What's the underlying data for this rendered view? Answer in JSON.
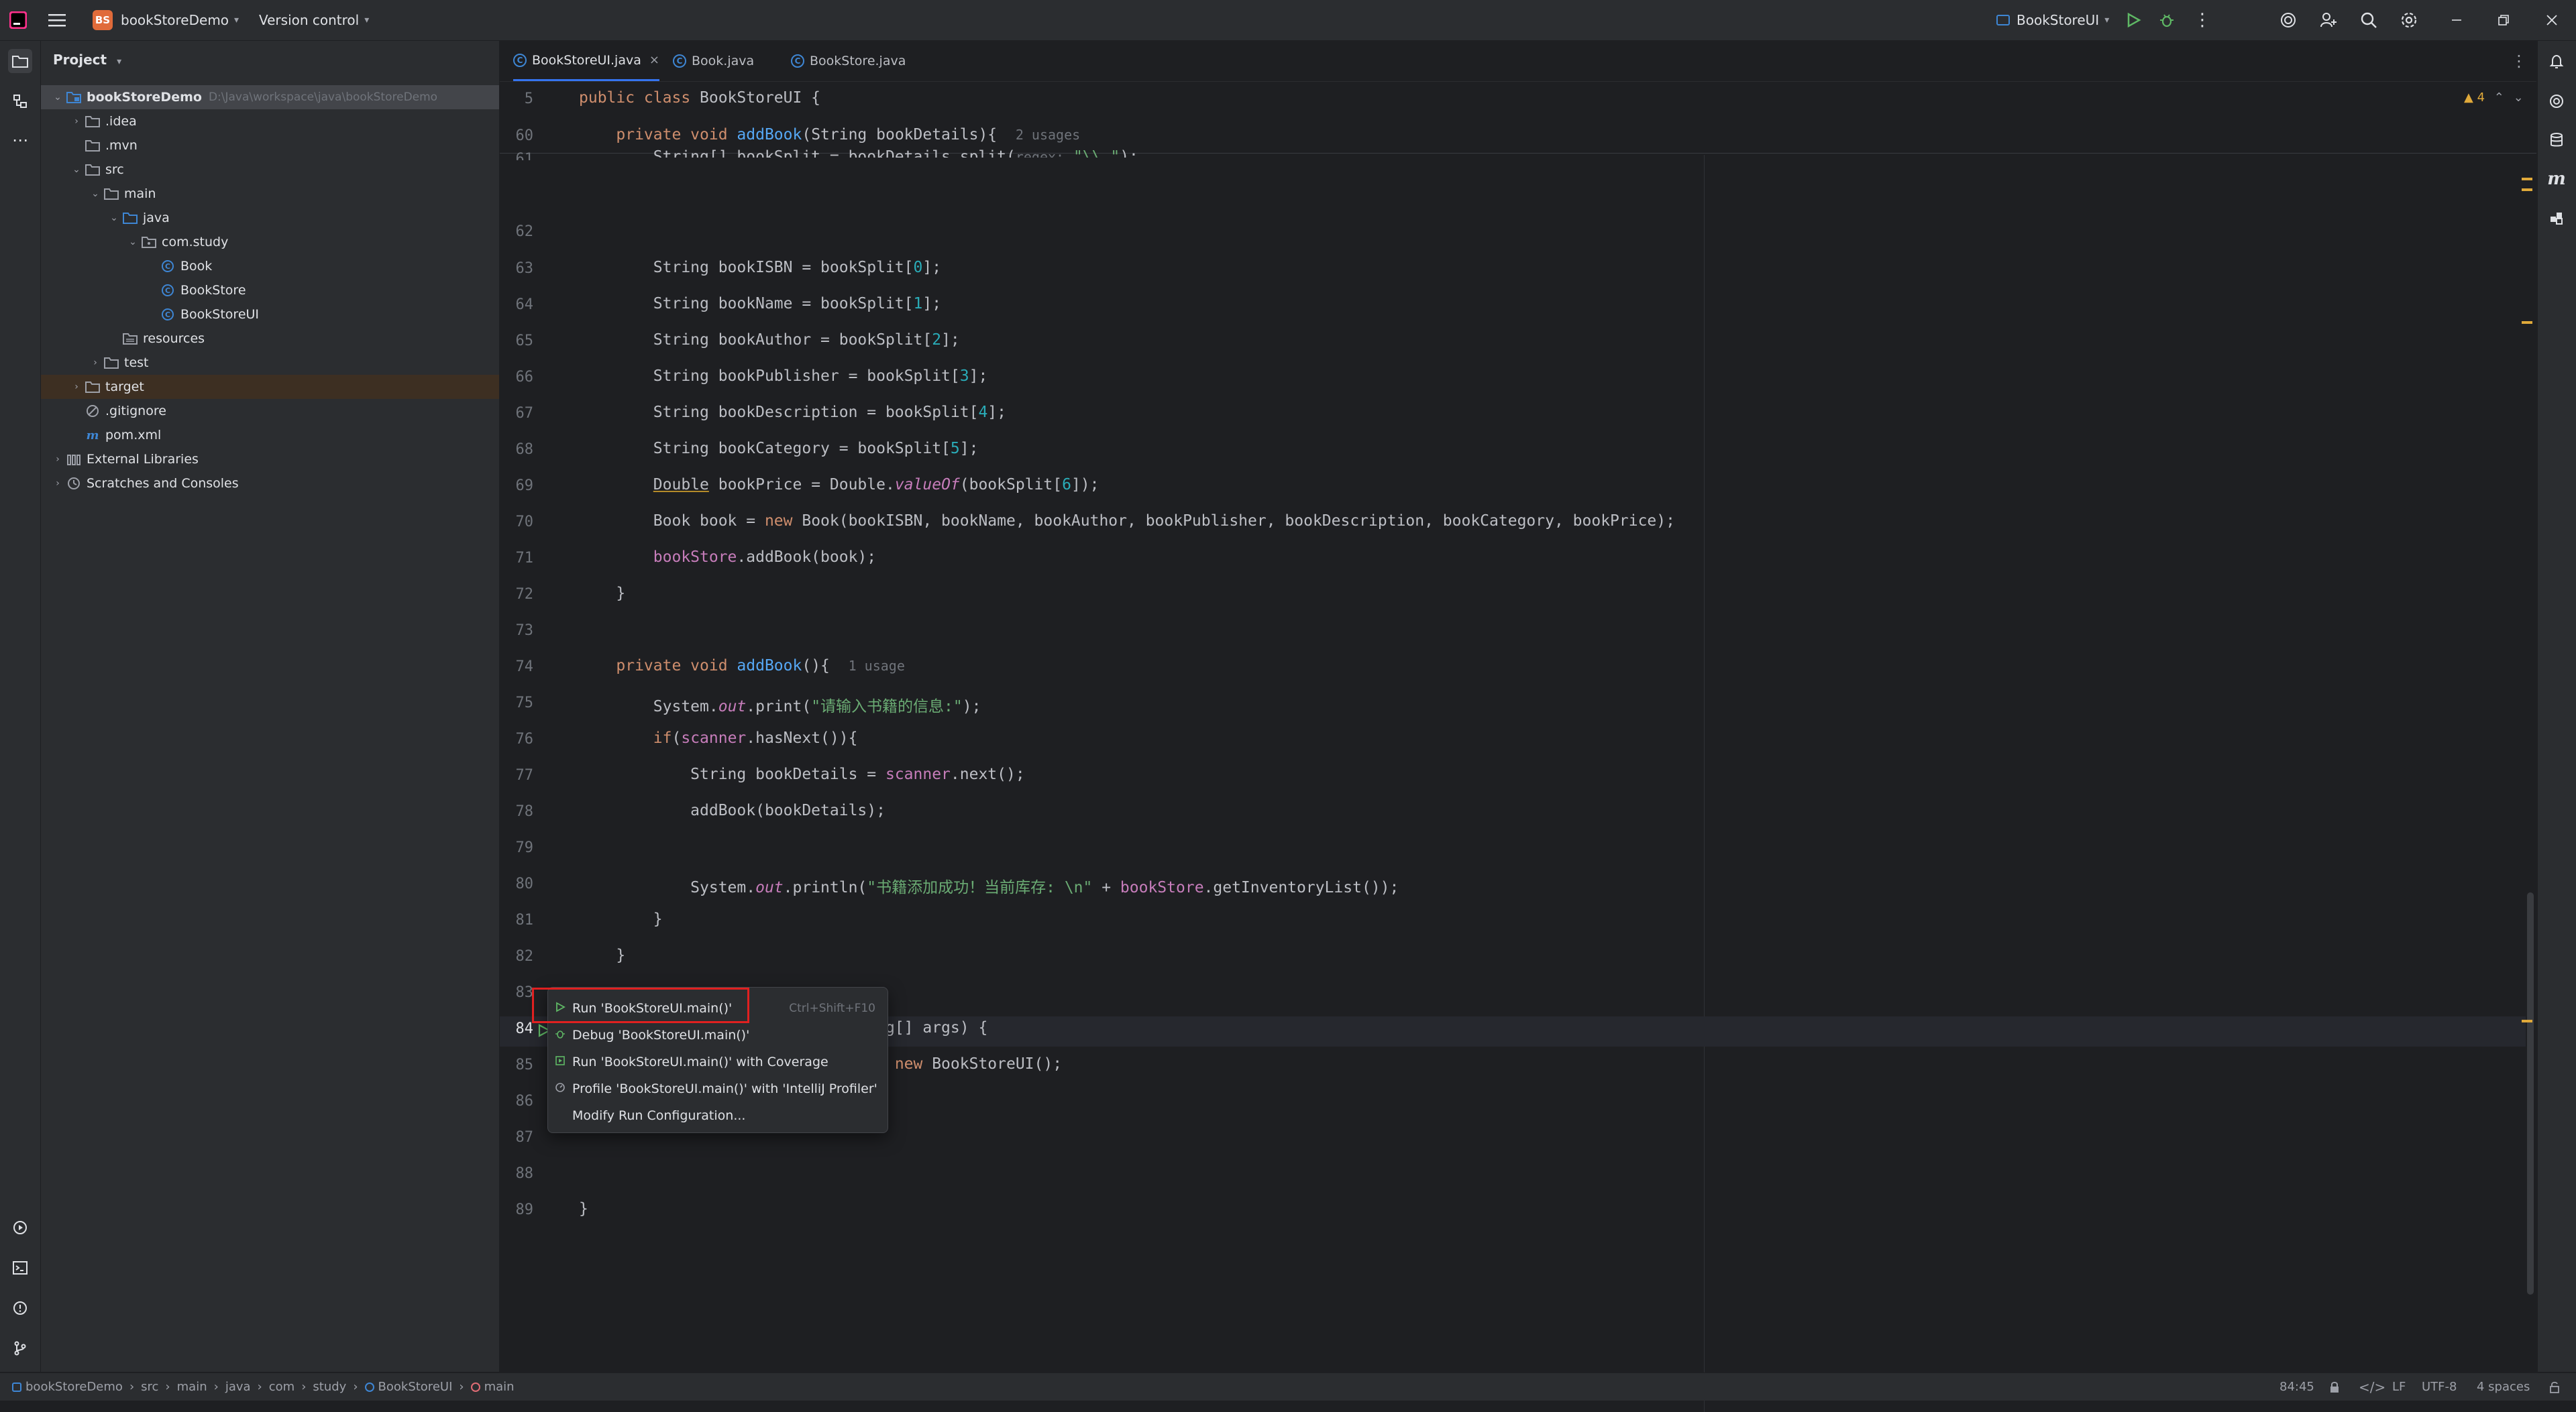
{
  "titlebar": {
    "project_initials": "BS",
    "project_name": "bookStoreDemo",
    "version_control": "Version control",
    "run_config": "BookStoreUI"
  },
  "project_panel": {
    "title": "Project",
    "tree": [
      {
        "label": "bookStoreDemo",
        "hint": "D:\\Java\\workspace\\java\\bookStoreDemo",
        "icon": "module-folder-icon",
        "arrow": "down",
        "depth": 0
      },
      {
        "label": ".idea",
        "icon": "folder-icon",
        "arrow": "right",
        "depth": 1
      },
      {
        "label": ".mvn",
        "icon": "folder-icon",
        "arrow": "",
        "depth": 1
      },
      {
        "label": "src",
        "icon": "folder-icon",
        "arrow": "down",
        "depth": 1
      },
      {
        "label": "main",
        "icon": "folder-icon",
        "arrow": "down",
        "depth": 2
      },
      {
        "label": "java",
        "icon": "source-folder-icon",
        "arrow": "down",
        "depth": 3
      },
      {
        "label": "com.study",
        "icon": "package-icon",
        "arrow": "down",
        "depth": 4
      },
      {
        "label": "Book",
        "icon": "class-icon",
        "arrow": "",
        "depth": 5
      },
      {
        "label": "BookStore",
        "icon": "class-icon",
        "arrow": "",
        "depth": 5
      },
      {
        "label": "BookStoreUI",
        "icon": "class-icon",
        "arrow": "",
        "depth": 5
      },
      {
        "label": "resources",
        "icon": "resources-folder-icon",
        "arrow": "",
        "depth": 3
      },
      {
        "label": "test",
        "icon": "folder-icon",
        "arrow": "right",
        "depth": 2
      },
      {
        "label": "target",
        "icon": "folder-icon",
        "arrow": "right",
        "depth": 1
      },
      {
        "label": ".gitignore",
        "icon": "gitignore-icon",
        "arrow": "",
        "depth": 1
      },
      {
        "label": "pom.xml",
        "icon": "maven-icon",
        "arrow": "",
        "depth": 1
      },
      {
        "label": "External Libraries",
        "icon": "library-icon",
        "arrow": "right",
        "depth": 0
      },
      {
        "label": "Scratches and Consoles",
        "icon": "scratch-icon",
        "arrow": "right",
        "depth": 0
      }
    ]
  },
  "tabs": [
    {
      "label": "BookStoreUI.java",
      "active": true
    },
    {
      "label": "Book.java",
      "active": false
    },
    {
      "label": "BookStore.java",
      "active": false
    }
  ],
  "editor": {
    "warnings_count": "4",
    "lines": [
      "5",
      "60",
      "61",
      "62",
      "63",
      "64",
      "65",
      "66",
      "67",
      "68",
      "69",
      "70",
      "71",
      "72",
      "73",
      "74",
      "75",
      "76",
      "77",
      "78",
      "79",
      "80",
      "81",
      "82",
      "83",
      "84",
      "85",
      "86",
      "87",
      "88",
      "89"
    ],
    "sticky_class": "public class BookStoreUI {",
    "usages_2": "2 usages",
    "usages_1": "1 usage",
    "regex_hint": "regex:",
    "split_arg": "\"\\\\ \"",
    "str_prompt": "\"请输入书籍的信息:\"",
    "str_success": "\"书籍添加成功！当前库存: \\n\""
  },
  "popup": {
    "items": [
      {
        "label": "Run 'BookStoreUI.main()'",
        "shortcut": "Ctrl+Shift+F10",
        "icon": "run-icon"
      },
      {
        "label": "Debug 'BookStoreUI.main()'",
        "shortcut": "",
        "icon": "debug-icon"
      },
      {
        "label": "Run 'BookStoreUI.main()' with Coverage",
        "shortcut": "",
        "icon": "coverage-icon"
      },
      {
        "label": "Profile 'BookStoreUI.main()' with 'IntelliJ Profiler'",
        "shortcut": "",
        "icon": "profiler-icon"
      },
      {
        "label": "Modify Run Configuration...",
        "shortcut": "",
        "icon": ""
      }
    ]
  },
  "statusbar": {
    "breadcrumbs": [
      "bookStoreDemo",
      "src",
      "main",
      "java",
      "com",
      "study",
      "BookStoreUI",
      "main"
    ],
    "position": "84:45",
    "line_sep": "LF",
    "encoding": "UTF-8",
    "indent": "4 spaces"
  },
  "colors": {
    "accent": "#3574f0",
    "run_green": "#5fb865",
    "highlight_red": "#e02020",
    "warning": "#e0a93a"
  }
}
